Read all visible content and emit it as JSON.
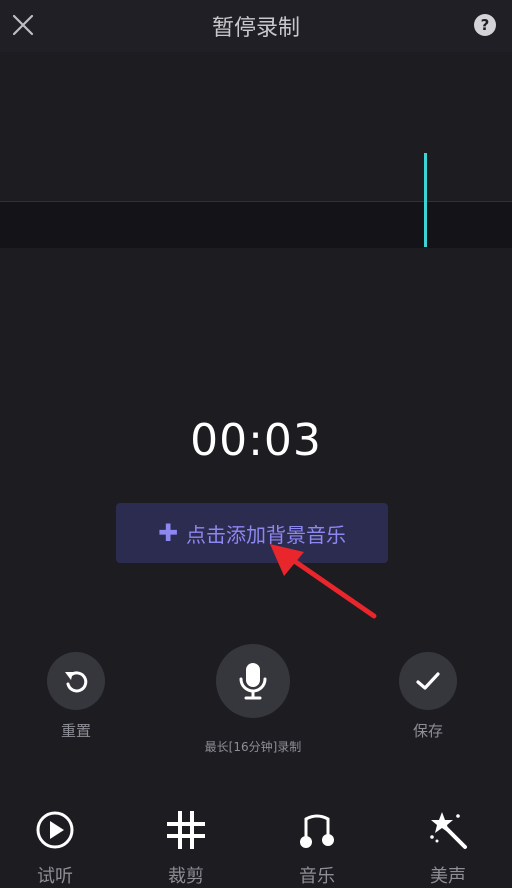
{
  "header": {
    "title": "暂停录制",
    "close_icon": "close-icon",
    "help_icon": "help-icon",
    "help_glyph": "?"
  },
  "timer": {
    "value": "00:03"
  },
  "bgm_button": {
    "label": "点击添加背景音乐",
    "icon": "plus-icon"
  },
  "controls": {
    "reset": {
      "label": "重置",
      "icon": "reset-icon"
    },
    "record": {
      "label": "最长[16分钟]录制",
      "icon": "microphone-icon"
    },
    "save": {
      "label": "保存",
      "icon": "check-icon"
    }
  },
  "tabs": [
    {
      "label": "试听",
      "icon": "play-circle-icon"
    },
    {
      "label": "裁剪",
      "icon": "crop-hash-icon"
    },
    {
      "label": "音乐",
      "icon": "music-note-icon"
    },
    {
      "label": "美声",
      "icon": "magic-wand-icon"
    }
  ],
  "colors": {
    "background": "#1c1c21",
    "accent": "#8d87f0",
    "accent_bg": "#2c2b50",
    "playhead": "#3fd4d4",
    "annotation_arrow": "#e8262b"
  }
}
